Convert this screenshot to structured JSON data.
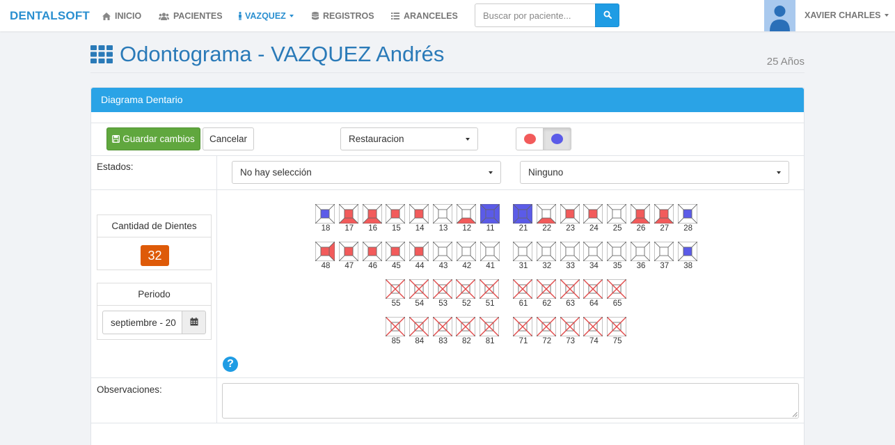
{
  "navbar": {
    "brand": "DENTALSOFT",
    "items": [
      {
        "label": "INICIO",
        "icon": "home-icon"
      },
      {
        "label": "PACIENTES",
        "icon": "users-icon"
      },
      {
        "label": "VAZQUEZ",
        "icon": "person-icon",
        "active": true
      },
      {
        "label": "REGISTROS",
        "icon": "database-icon"
      },
      {
        "label": "ARANCELES",
        "icon": "list-icon"
      }
    ],
    "search_placeholder": "Buscar por paciente...",
    "user_name": "XAVIER CHARLES"
  },
  "header": {
    "title": "Odontograma - VAZQUEZ Andrés",
    "age": "25 Años"
  },
  "panel": {
    "title": "Diagrama Dentario",
    "save_label": "Guardar cambios",
    "cancel_label": "Cancelar",
    "tool_selected": "Restauracion",
    "colors": {
      "red": "#f25b5b",
      "blue": "#5b5be8",
      "accent": "#2aa3e6",
      "save": "#60a73e",
      "badge": "#de5a08"
    },
    "estados_label": "Estados:",
    "estado_select": "No hay selección",
    "estado_select_2": "Ninguno",
    "count_label": "Cantidad de Dientes",
    "count_value": "32",
    "period_label": "Periodo",
    "period_value": "septiembre - 20",
    "observaciones_label": "Observaciones:"
  },
  "teeth": {
    "row1": [
      {
        "n": "18",
        "s": "b:c"
      },
      {
        "n": "17",
        "s": "r:c,b"
      },
      {
        "n": "16",
        "s": "r:c,b"
      },
      {
        "n": "15",
        "s": "r:c"
      },
      {
        "n": "14",
        "s": "r:c"
      },
      {
        "n": "13",
        "s": ""
      },
      {
        "n": "12",
        "s": "r:b"
      },
      {
        "n": "11",
        "s": "b:all"
      },
      {
        "n": "21",
        "s": "b:all"
      },
      {
        "n": "22",
        "s": "r:b"
      },
      {
        "n": "23",
        "s": "r:c"
      },
      {
        "n": "24",
        "s": "r:c"
      },
      {
        "n": "25",
        "s": ""
      },
      {
        "n": "26",
        "s": "r:c,b"
      },
      {
        "n": "27",
        "s": "r:c,b"
      },
      {
        "n": "28",
        "s": "b:c"
      }
    ],
    "row2": [
      {
        "n": "48",
        "s": "r:c,r"
      },
      {
        "n": "47",
        "s": "r:c"
      },
      {
        "n": "46",
        "s": "r:c"
      },
      {
        "n": "45",
        "s": "r:c"
      },
      {
        "n": "44",
        "s": "r:c"
      },
      {
        "n": "43",
        "s": ""
      },
      {
        "n": "42",
        "s": ""
      },
      {
        "n": "41",
        "s": ""
      },
      {
        "n": "31",
        "s": ""
      },
      {
        "n": "32",
        "s": ""
      },
      {
        "n": "33",
        "s": ""
      },
      {
        "n": "34",
        "s": ""
      },
      {
        "n": "35",
        "s": ""
      },
      {
        "n": "36",
        "s": ""
      },
      {
        "n": "37",
        "s": ""
      },
      {
        "n": "38",
        "s": "b:c"
      }
    ],
    "row3": [
      {
        "n": "55",
        "s": "x"
      },
      {
        "n": "54",
        "s": "x"
      },
      {
        "n": "53",
        "s": "x"
      },
      {
        "n": "52",
        "s": "x"
      },
      {
        "n": "51",
        "s": "x"
      },
      {
        "n": "61",
        "s": "x"
      },
      {
        "n": "62",
        "s": "x"
      },
      {
        "n": "63",
        "s": "x"
      },
      {
        "n": "64",
        "s": "x"
      },
      {
        "n": "65",
        "s": "x"
      }
    ],
    "row4": [
      {
        "n": "85",
        "s": "x"
      },
      {
        "n": "84",
        "s": "x"
      },
      {
        "n": "83",
        "s": "x"
      },
      {
        "n": "82",
        "s": "x"
      },
      {
        "n": "81",
        "s": "x"
      },
      {
        "n": "71",
        "s": "x"
      },
      {
        "n": "72",
        "s": "x"
      },
      {
        "n": "73",
        "s": "x"
      },
      {
        "n": "74",
        "s": "x"
      },
      {
        "n": "75",
        "s": "x"
      }
    ]
  }
}
